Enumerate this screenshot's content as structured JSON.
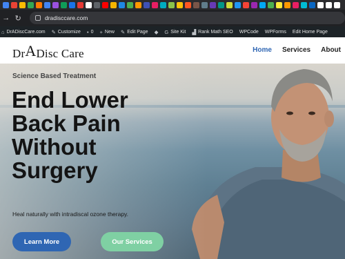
{
  "browser": {
    "favicon_colors": [
      "#4285f4",
      "#ea4335",
      "#fbbc04",
      "#34a853",
      "#ff7a00",
      "#4285f4",
      "#9b51e0",
      "#0f9d58",
      "#1a73e8",
      "#e53935",
      "#ffffff",
      "#5f6368",
      "#ff0000",
      "#f4b400",
      "#1e88e5",
      "#4caf50",
      "#ff9800",
      "#3f51b5",
      "#e91e63",
      "#00acc1",
      "#8bc34a",
      "#ffc107",
      "#ff5722",
      "#795548",
      "#607d8b",
      "#673ab7",
      "#009688",
      "#cddc39",
      "#2196f3",
      "#f44336",
      "#9c27b0",
      "#03a9f4",
      "#4caf50",
      "#ffeb3b",
      "#ff9800",
      "#e91e63",
      "#00bcd4",
      "#0a66c2",
      "#ffffff",
      "#ffffff",
      "#ffffff"
    ],
    "back_icon": "arrow-right-icon",
    "reload_icon": "reload-icon",
    "url": "dradisccare.com"
  },
  "wp_admin": {
    "site_name": "DrADiscCare.com",
    "customize": "Customize",
    "comments_count": "0",
    "new": "New",
    "edit_page": "Edit Page",
    "site_kit": "Site Kit",
    "rank_math": "Rank Math SEO",
    "wpcode": "WPCode",
    "wpforms": "WPForms",
    "edit_home_page": "Edit Home Page"
  },
  "header": {
    "logo": {
      "prefix": "Dr",
      "cap": "A",
      "suffix": "Disc Care"
    },
    "nav": [
      {
        "label": "Home",
        "active": true
      },
      {
        "label": "Services",
        "active": false
      },
      {
        "label": "About",
        "active": false
      }
    ]
  },
  "hero": {
    "eyebrow": "Science Based Treatment",
    "headline": [
      "End Lower",
      "Back Pain",
      "Without",
      "Surgery"
    ],
    "subtitle": "Heal naturally with intradiscal ozone therapy.",
    "primary_cta": "Learn More",
    "secondary_cta": "Our Services",
    "colors": {
      "primary": "#2f66b3",
      "secondary": "#7fd0a3"
    }
  }
}
